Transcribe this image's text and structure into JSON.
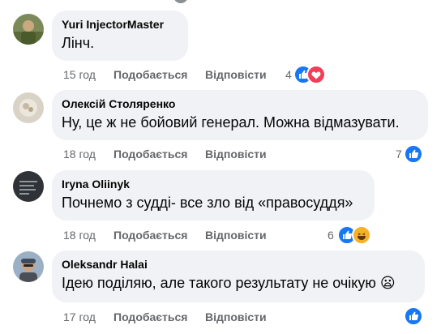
{
  "comments": [
    {
      "author": "Yuri InjectorMaster",
      "text": "Лінч.",
      "time": "15 год",
      "like": "Подобається",
      "reply": "Відповісти",
      "reactions_count": "4",
      "reactions": [
        "like-icon",
        "love-icon"
      ]
    },
    {
      "author": "Олексій Столяренко",
      "text": "Ну, це ж не бойовий генерал. Можна відмазувати.",
      "time": "18 год",
      "like": "Подобається",
      "reply": "Відповісти",
      "reactions_count": "7",
      "reactions": [
        "like-icon"
      ]
    },
    {
      "author": "Iryna Oliinyk",
      "text": "Почнемо з судді- все зло від «правосуддя»",
      "time": "18 год",
      "like": "Подобається",
      "reply": "Відповісти",
      "reactions_count": "6",
      "reactions": [
        "like-icon",
        "haha-icon"
      ]
    },
    {
      "author": "Oleksandr Halai",
      "text": "Ідею поділяю, але такого результату не очікую 😦",
      "time": "17 год",
      "like": "Подобається",
      "reply": "Відповісти",
      "reactions_count": "",
      "reactions": [
        "like-icon"
      ]
    }
  ],
  "colors": {
    "bubble": "#f0f2f5",
    "meta": "#65676b",
    "like": "#1877f2",
    "love": "#f33e58",
    "haha": "#f7b125"
  }
}
